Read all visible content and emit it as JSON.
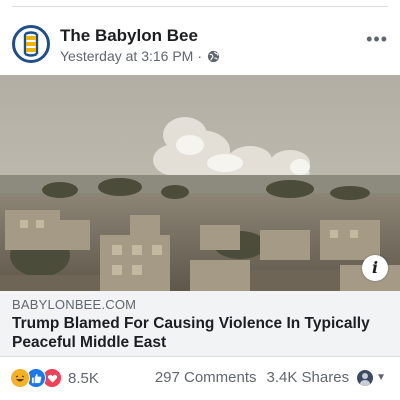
{
  "post": {
    "page_name": "The Babylon Bee",
    "timestamp": "Yesterday at 3:16 PM",
    "separator": "·",
    "privacy_icon": "globe-icon",
    "more_icon": "more-options-icon"
  },
  "media": {
    "info_badge": "i"
  },
  "link": {
    "domain": "BABYLONBEE.COM",
    "headline": "Trump Blamed For Causing Violence In Typically Peaceful Middle East"
  },
  "stats": {
    "reaction_icons": [
      "haha-reaction-icon",
      "like-reaction-icon",
      "love-reaction-icon"
    ],
    "reaction_count": "8.5K",
    "comments": "297 Comments",
    "shares": "3.4K Shares"
  },
  "colors": {
    "link_preview_bg": "#f2f3f5",
    "secondary_text": "#606770",
    "like_blue": "#1877f2",
    "love_red": "#f33e58",
    "haha_yellow": "#f7b125",
    "logo_blue": "#1f4e8c"
  }
}
